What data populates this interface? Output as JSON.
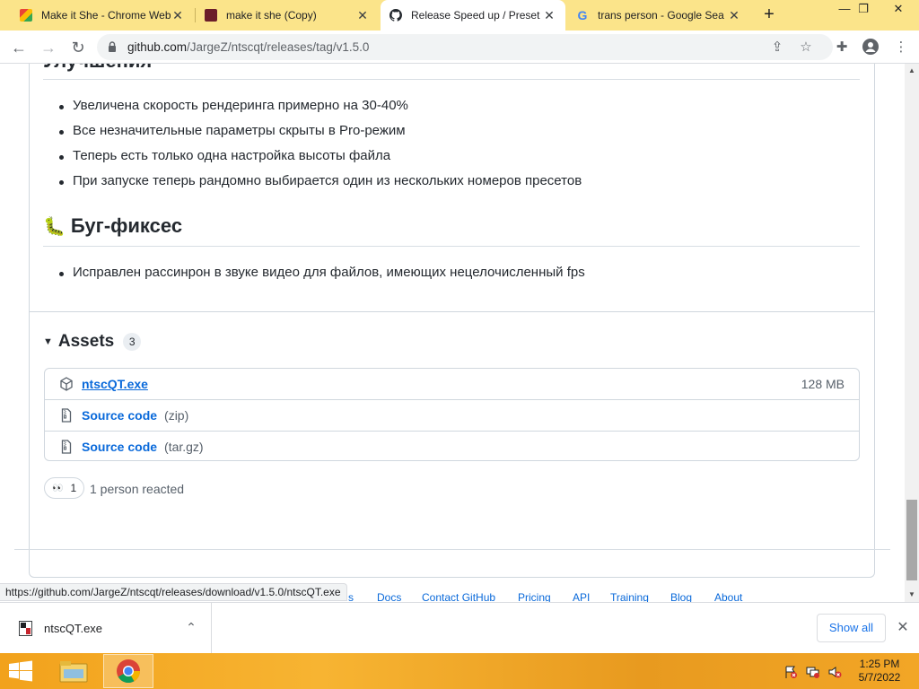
{
  "browser": {
    "tabs": [
      {
        "title": "Make it She - Chrome Web",
        "favicon": "chrome-web-store-icon",
        "active": false
      },
      {
        "title": "make it she (Copy)",
        "favicon": "editor-icon",
        "active": false
      },
      {
        "title": "Release Speed up / Preset",
        "favicon": "github-icon",
        "active": true
      },
      {
        "title": "trans person - Google Sea",
        "favicon": "google-icon",
        "active": false
      }
    ],
    "new_tab": "+",
    "window_controls": {
      "minimize": "—",
      "maximize": "❐",
      "close": "✕"
    },
    "address": {
      "host": "github.com",
      "path": "/JargeZ/ntscqt/releases/tag/v1.5.0"
    }
  },
  "release": {
    "section1_title": "Улучшения",
    "improvements": [
      "Увеличена скорость рендеринга примерно на 30-40%",
      "Все незначительные параметры скрыты в Pro-режим",
      "Теперь есть только одна настройка высоты файла",
      "При запуске теперь рандомно выбирается один из нескольких номеров пресетов"
    ],
    "bugfix_emoji": "🐛",
    "section2_title": "Буг-фиксес",
    "bugfixes": [
      "Исправлен рассинрон в звуке видео для файлов, имеющих нецелочисленный fps"
    ],
    "assets": {
      "label": "Assets",
      "count": "3",
      "items": [
        {
          "name": "ntscQT.exe",
          "ext": "",
          "size": "128 MB",
          "icon": "package-icon"
        },
        {
          "name": "Source code",
          "ext": "(zip)",
          "size": "",
          "icon": "file-zip-icon"
        },
        {
          "name": "Source code",
          "ext": "(tar.gz)",
          "size": "",
          "icon": "file-zip-icon"
        }
      ]
    },
    "reaction": {
      "emoji": "👀",
      "count": "1",
      "text": "1 person reacted"
    }
  },
  "footer": {
    "partial": "s",
    "links": [
      "Docs",
      "Contact GitHub",
      "Pricing",
      "API",
      "Training",
      "Blog",
      "About"
    ]
  },
  "status_url": "https://github.com/JargeZ/ntscqt/releases/download/v1.5.0/ntscQT.exe",
  "downloads": {
    "file": "ntscQT.exe",
    "show_all": "Show all"
  },
  "taskbar": {
    "time": "1:25 PM",
    "date": "5/7/2022"
  },
  "colors": {
    "tabstrip": "#fbe48a",
    "link": "#0969da",
    "taskbar": "#f2a21c"
  }
}
